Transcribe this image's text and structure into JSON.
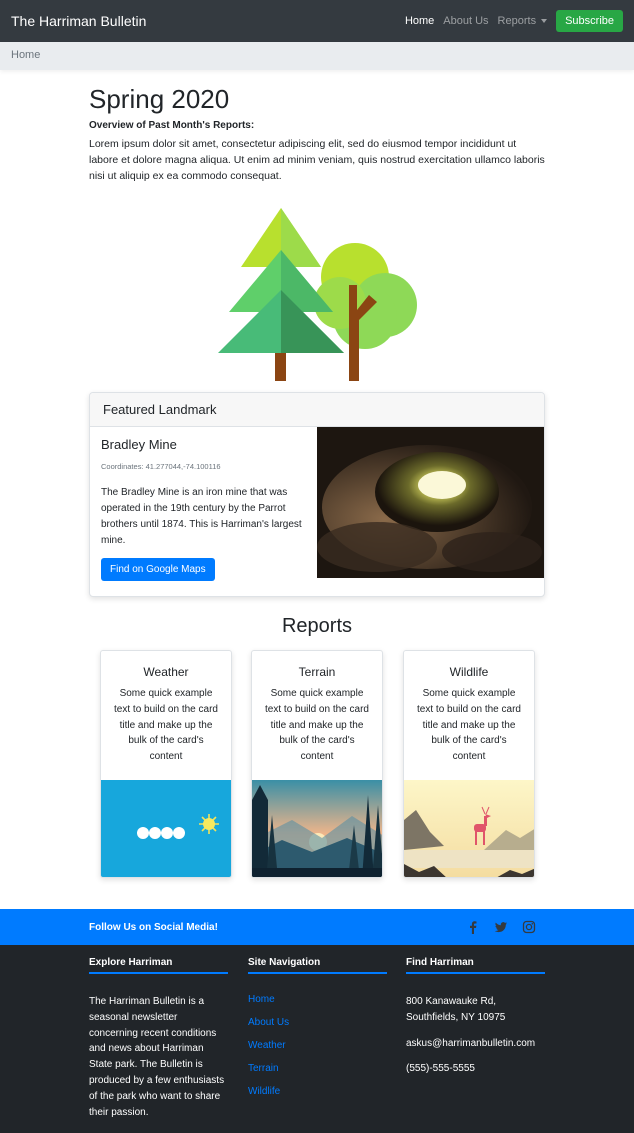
{
  "navbar": {
    "brand": "The Harriman Bulletin",
    "links": [
      {
        "label": "Home"
      },
      {
        "label": "About Us"
      },
      {
        "label": "Reports"
      }
    ],
    "subscribe_label": "Subscribe"
  },
  "breadcrumb": {
    "current": "Home"
  },
  "intro": {
    "title": "Spring 2020",
    "subtitle": "Overview of Past Month's Reports:",
    "body": "Lorem ipsum dolor sit amet, consectetur adipiscing elit, sed do eiusmod tempor incididunt ut labore et dolore magna aliqua. Ut enim ad minim veniam, quis nostrud exercitation ullamco laboris nisi ut aliquip ex ea commodo consequat."
  },
  "featured": {
    "header": "Featured Landmark",
    "title": "Bradley Mine",
    "coordinates": "Coordinates: 41.277044,-74.100116",
    "description": "The Bradley Mine is an iron mine that was operated in the 19th century by the Parrot brothers until 1874. This is Harriman's largest mine.",
    "button_label": "Find on Google Maps"
  },
  "reports": {
    "title": "Reports",
    "cards": [
      {
        "title": "Weather",
        "text": "Some quick example text to build on the card title and make up the bulk of the card's content"
      },
      {
        "title": "Terrain",
        "text": "Some quick example text to build on the card title and make up the bulk of the card's content"
      },
      {
        "title": "Wildlife",
        "text": "Some quick example text to build on the card title and make up the bulk of the card's content"
      }
    ]
  },
  "social": {
    "text": "Follow Us on Social Media!",
    "icons": [
      "facebook-icon",
      "twitter-icon",
      "instagram-icon"
    ]
  },
  "footer": {
    "about_heading": "Explore Harriman",
    "about_text": "The Harriman Bulletin is a seasonal newsletter concerning recent conditions and news about Harriman State park. The Bulletin is produced by a few enthusiasts of the park who want to share their passion.",
    "nav_heading": "Site Navigation",
    "nav_links": [
      "Home",
      "About Us",
      "Weather",
      "Terrain",
      "Wildlife"
    ],
    "find_heading": "Find Harriman",
    "address_line1": "800 Kanawauke Rd,",
    "address_line2": "Southfields, NY 10975",
    "email": "askus@harrimanbulletin.com",
    "phone": "(555)-555-5555"
  },
  "colors": {
    "navbar": "#343a40",
    "primary": "#007bff",
    "success": "#28a745",
    "footer": "#212529"
  }
}
